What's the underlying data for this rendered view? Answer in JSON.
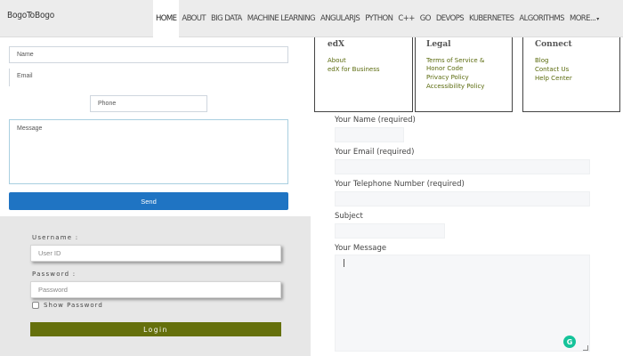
{
  "brand": "BogoToBogo",
  "nav": {
    "items": [
      "HOME",
      "ABOUT",
      "BIG DATA",
      "MACHINE LEARNING",
      "ANGULARJS",
      "PYTHON",
      "C++",
      "GO",
      "DEVOPS",
      "KUBERNETES",
      "ALGORITHMS",
      "MORE..."
    ],
    "active": "HOME",
    "more_caret": "▾"
  },
  "left_form": {
    "name_placeholder": "Name",
    "email_placeholder": "Email",
    "phone_placeholder": "Phone",
    "message_placeholder": "Message",
    "send_label": "Send"
  },
  "login": {
    "username_label": "Username :",
    "username_placeholder": "User ID",
    "password_label": "Password :",
    "password_placeholder": "Password",
    "show_password_label": "Show Password",
    "login_label": "Login",
    "button_color": "#65700c"
  },
  "footer_boxes": [
    {
      "title": "edX",
      "links": [
        "About",
        "edX for Business"
      ]
    },
    {
      "title": "Legal",
      "links": [
        "Terms of Service &",
        "Honor Code",
        "Privacy Policy",
        "Accessibility Policy"
      ]
    },
    {
      "title": "Connect",
      "links": [
        "Blog",
        "Contact Us",
        "Help Center"
      ]
    }
  ],
  "right_form": {
    "name_label": "Your Name (required)",
    "email_label": "Your Email (required)",
    "phone_label": "Your Telephone Number (required)",
    "subject_label": "Subject",
    "message_label": "Your Message",
    "grammarly_letter": "G"
  },
  "colors": {
    "send_button": "#1f74c3",
    "link_color": "#5a6a0c",
    "grammarly": "#15c39a"
  }
}
